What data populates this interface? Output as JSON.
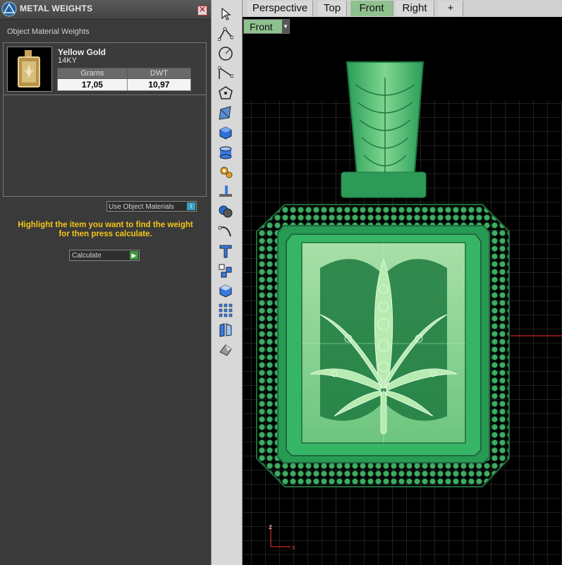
{
  "panel": {
    "title": "METAL WEIGHTS",
    "close_glyph": "✕",
    "section_label": "Object Material Weights",
    "material": {
      "name": "Yellow Gold",
      "alloy": "14KY",
      "columns": [
        "Grams",
        "DWT"
      ],
      "grams": "17,05",
      "dwt": "10,97"
    },
    "use_materials_label": "Use Object Materials",
    "hint_line1": "Highlight the item you want to find the weight",
    "hint_line2": "for then press calculate.",
    "calculate_label": "Calculate"
  },
  "viewport": {
    "tabs": [
      "Perspective",
      "Top",
      "Front",
      "Right"
    ],
    "active_tab": "Front",
    "add_tab_glyph": "+",
    "view_selector": "Front",
    "axis_z": "z",
    "axis_x": "x"
  },
  "toolbar": {
    "icons": [
      "cursor-icon",
      "polyline-icon",
      "circle-icon",
      "arc-icon",
      "polygon-icon",
      "surface-icon",
      "box-icon",
      "cylinder-icon",
      "gear-icon",
      "extrude-icon",
      "boolean-icon",
      "curve-icon",
      "text-icon",
      "array-icon",
      "cube-icon",
      "grid-icon",
      "mirror-icon",
      "shade-icon"
    ]
  },
  "colors": {
    "accent_green": "#8fc18f",
    "pendant_green": "#2f9f5c",
    "hint_yellow": "#f5c518"
  }
}
